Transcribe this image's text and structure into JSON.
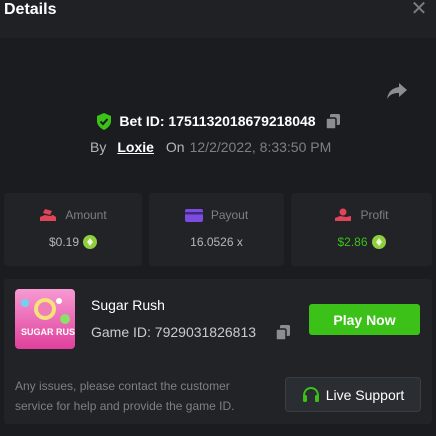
{
  "header": {
    "title": "Details",
    "close_icon": "close-icon"
  },
  "bet": {
    "bet_id_label": "Bet ID: 1751132018679218048",
    "by_label": "By",
    "username": "Loxie",
    "on_label": "On",
    "date": "12/2/2022, 8:33:50 PM"
  },
  "stats": {
    "amount": {
      "label": "Amount",
      "value": "$0.19",
      "icon": "money-hand-icon"
    },
    "payout": {
      "label": "Payout",
      "value": "16.0526 x",
      "icon": "card-icon"
    },
    "profit": {
      "label": "Profit",
      "value": "$2.86",
      "icon": "profit-icon"
    }
  },
  "game": {
    "thumbnail_text": "SUGAR RUSH",
    "name": "Sugar Rush",
    "game_id_label": "Game ID: 7929031826813",
    "play_label": "Play Now"
  },
  "support": {
    "help_text": "Any issues, please contact the customer service for help and provide the game ID.",
    "button_label": "Live Support"
  },
  "colors": {
    "accent_green": "#3bc117",
    "background": "#1a1c1f",
    "panel": "#212327"
  }
}
